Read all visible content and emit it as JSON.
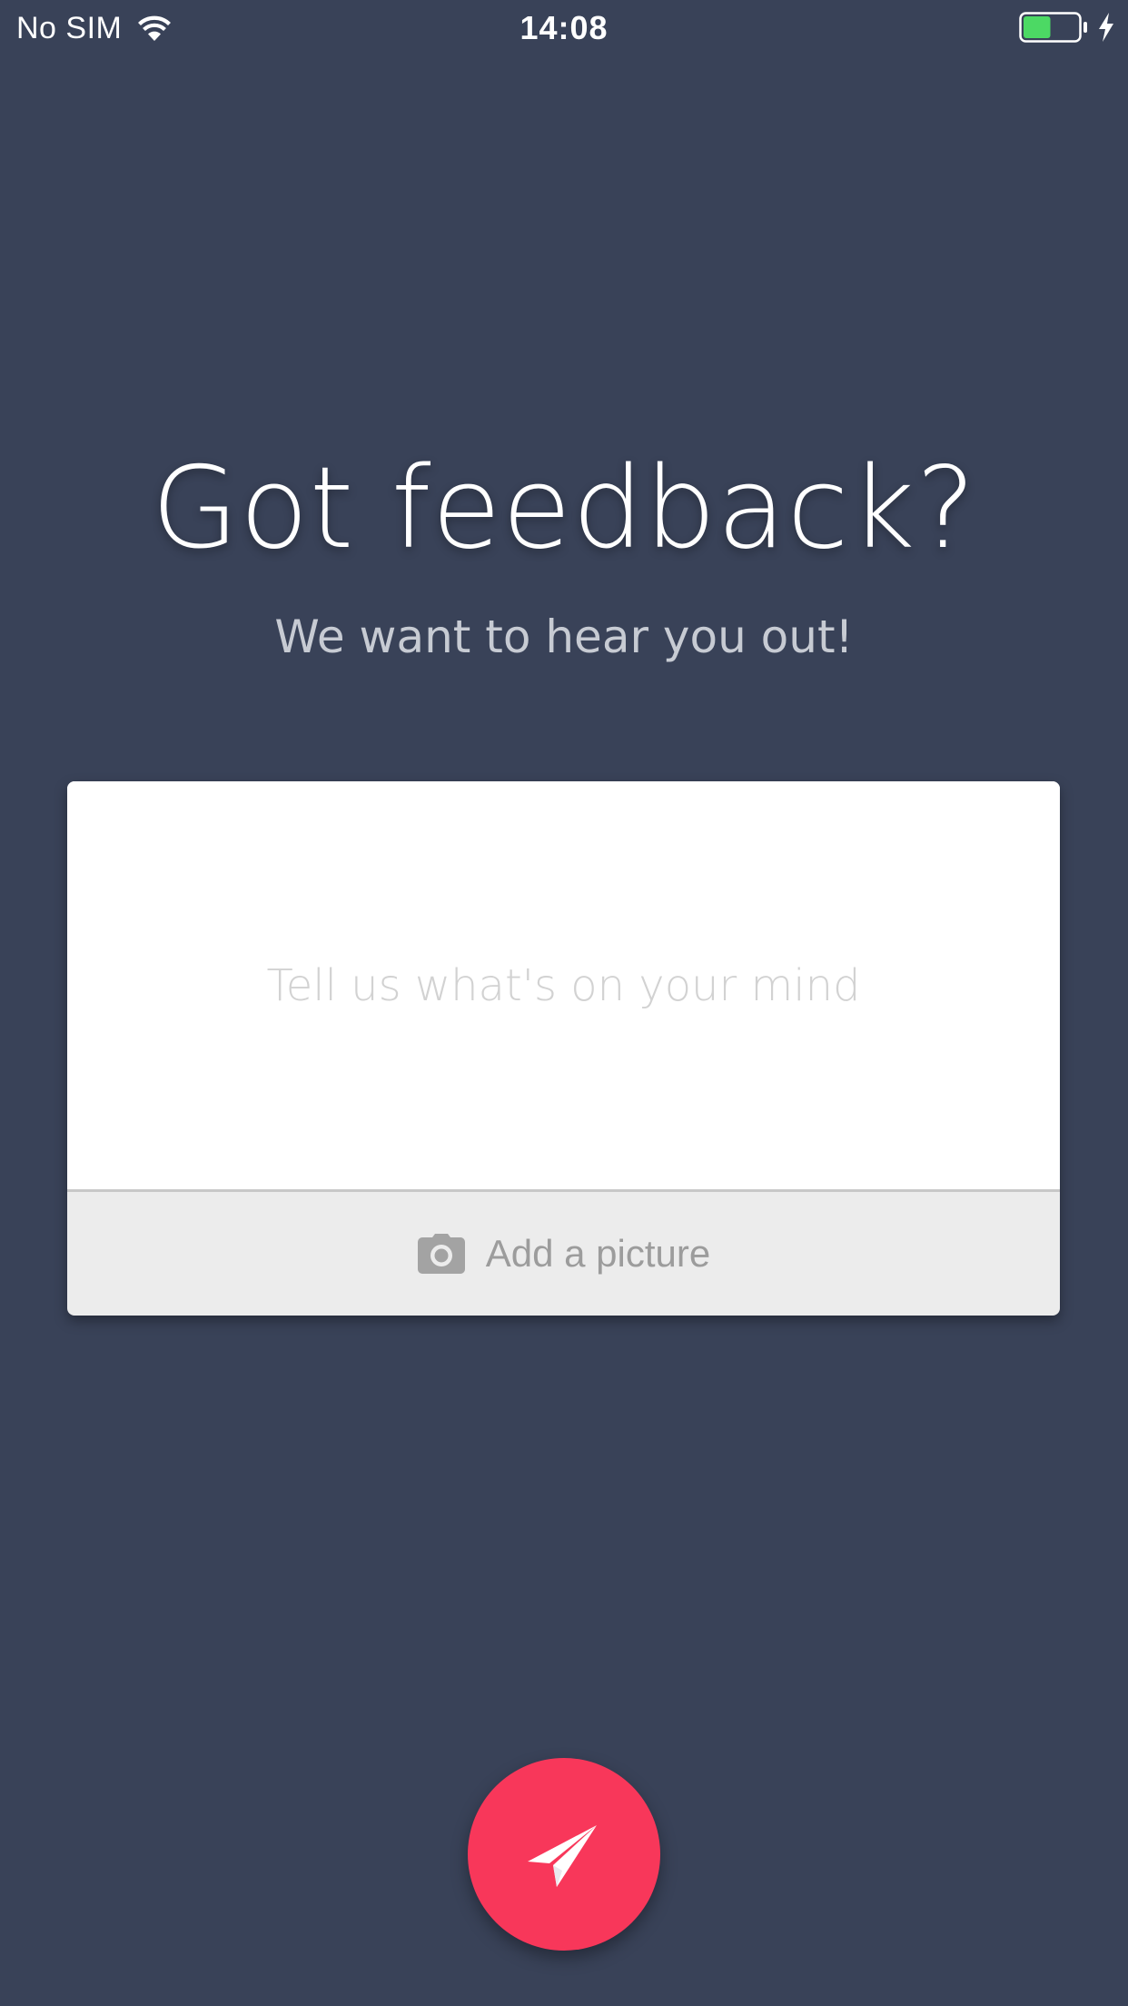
{
  "status_bar": {
    "carrier": "No SIM",
    "time": "14:08",
    "battery_level": 0.5,
    "battery_color": "#4cd964",
    "icons": [
      "wifi-icon",
      "battery-icon",
      "charging-icon"
    ]
  },
  "header": {
    "title": "Got feedback?",
    "subtitle": "We want to hear you out!"
  },
  "feedback_form": {
    "message_placeholder": "Tell us what's on your mind",
    "message_value": "",
    "add_picture_label": "Add a picture",
    "add_picture_icon": "camera-icon"
  },
  "send_button": {
    "icon": "paper-plane-icon",
    "color": "#f8375a"
  },
  "colors": {
    "background": "#394258"
  }
}
